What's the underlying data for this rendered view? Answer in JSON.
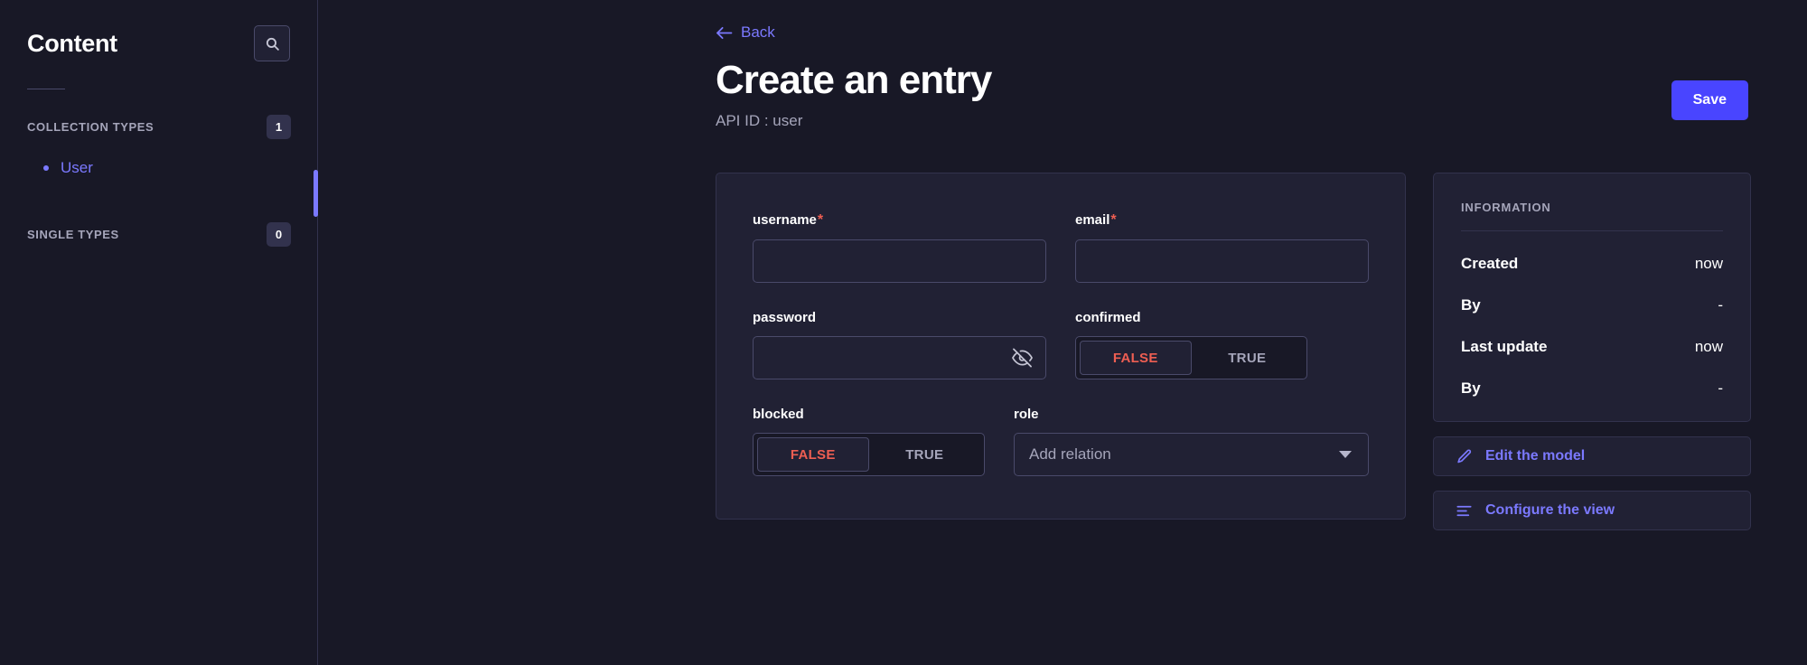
{
  "sidebar": {
    "title": "Content",
    "search_icon": "search-icon",
    "sections": [
      {
        "label": "COLLECTION TYPES",
        "count": "1"
      },
      {
        "label": "SINGLE TYPES",
        "count": "0"
      }
    ],
    "collection_items": [
      {
        "label": "User",
        "active": true
      }
    ]
  },
  "header": {
    "back_label": "Back",
    "back_icon": "arrow-left-icon",
    "title": "Create an entry",
    "api_id": "API ID : user",
    "save_label": "Save"
  },
  "form": {
    "fields": [
      {
        "name": "username",
        "label": "username",
        "required": "*",
        "type": "text",
        "value": "",
        "placeholder": ""
      },
      {
        "name": "email",
        "label": "email",
        "required": "*",
        "type": "text",
        "value": "",
        "placeholder": ""
      },
      {
        "name": "password",
        "label": "password",
        "required": "",
        "type": "password",
        "value": "",
        "placeholder": "",
        "toggle_icon": "eye-off-icon"
      },
      {
        "name": "confirmed",
        "label": "confirmed",
        "required": "",
        "type": "boolean",
        "options": [
          "FALSE",
          "TRUE"
        ],
        "selected": "FALSE"
      },
      {
        "name": "blocked",
        "label": "blocked",
        "required": "",
        "type": "boolean",
        "options": [
          "FALSE",
          "TRUE"
        ],
        "selected": "FALSE"
      },
      {
        "name": "role",
        "label": "role",
        "required": "",
        "type": "relation",
        "value": "Add relation",
        "caret_icon": "chevron-down-icon"
      }
    ]
  },
  "information": {
    "title": "INFORMATION",
    "rows": [
      {
        "key": "Created",
        "value": "now"
      },
      {
        "key": "By",
        "value": "-"
      },
      {
        "key": "Last update",
        "value": "now"
      },
      {
        "key": "By",
        "value": "-"
      }
    ]
  },
  "actions": [
    {
      "label": "Edit the model",
      "icon": "pencil-icon"
    },
    {
      "label": "Configure the view",
      "icon": "sliders-icon"
    }
  ],
  "colors": {
    "background": "#181826",
    "surface": "#212134",
    "border": "#32324d",
    "input_border": "#4a4a6a",
    "accent": "#4945ff",
    "link": "#7b79ff",
    "danger": "#ee5e52",
    "muted": "#a5a5ba"
  }
}
